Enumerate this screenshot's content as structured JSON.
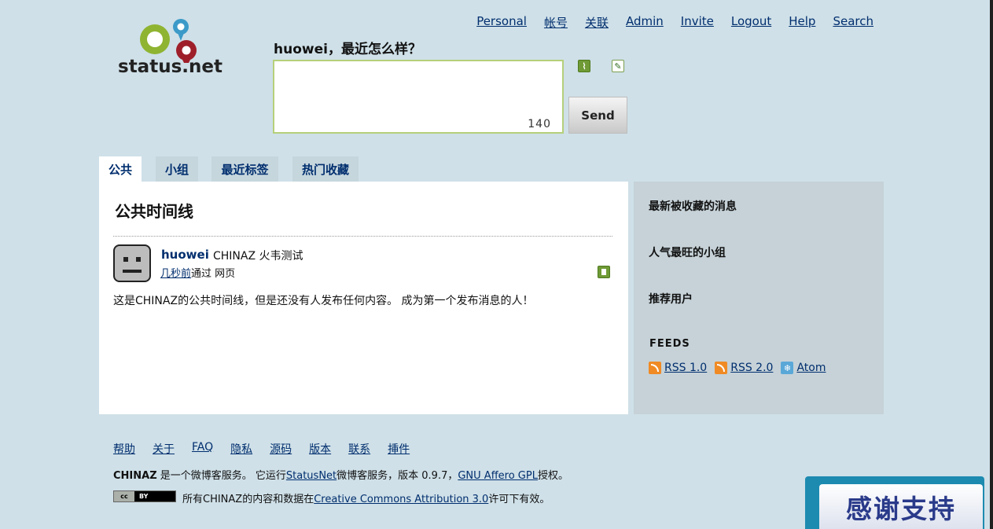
{
  "brand": {
    "logo_text": "status.net"
  },
  "top_nav": [
    "Personal",
    "帐号",
    "关联",
    "Admin",
    "Invite",
    "Logout",
    "Help",
    "Search"
  ],
  "notice_form": {
    "greeting": "huowei，最近怎么样？",
    "text": "",
    "counter": "140",
    "send_label": "Send"
  },
  "tabs": [
    "公共",
    "小组",
    "最近标签",
    "热门收藏"
  ],
  "main": {
    "title": "公共时间线",
    "notice": {
      "author": "huowei",
      "content": "CHINAZ 火韦测试",
      "time": "几秒前",
      "via_prefix": "通过",
      "source": "网页"
    },
    "empty_message": "这是CHINAZ的公共时间线，但是还没有人发布任何内容。 成为第一个发布消息的人！"
  },
  "sidebar": {
    "sections": [
      "最新被收藏的消息",
      "人气最旺的小组",
      "推荐用户"
    ],
    "feeds_title": "FEEDS",
    "feeds": [
      "RSS 1.0",
      "RSS 2.0",
      "Atom"
    ]
  },
  "footer": {
    "nav": [
      "帮助",
      "关于",
      "FAQ",
      "隐私",
      "源码",
      "版本",
      "联系",
      "挿件"
    ],
    "line1": {
      "site": "CHINAZ",
      "text_a": " 是一个微博客服务。 它运行",
      "link1": "StatusNet",
      "text_b": "微博客服务，版本 0.9.7，",
      "link2": "GNU Affero GPL",
      "text_c": "授权。"
    },
    "license": {
      "badge_cc": "cc",
      "badge_by": "BY",
      "text_a": "所有CHINAZ的内容和数据在",
      "link": "Creative Commons Attribution 3.0",
      "text_b": "许可下有效。"
    }
  },
  "banner": {
    "thanks": "感谢支持"
  },
  "colors": {
    "background": "#cfe0e8",
    "link": "#002e6e",
    "tab_inactive": "#c6d6dd",
    "sidebar": "#c6d2d8",
    "textarea_border": "#b5d07a",
    "icon_green": "#6f9a35",
    "banner_blue": "#1d8bb0"
  },
  "icons": {
    "attach": "paperclip-icon",
    "geo": "pin-icon",
    "favor": "favor-icon",
    "feed_rss": "rss-icon",
    "feed_atom": "atom-icon"
  }
}
